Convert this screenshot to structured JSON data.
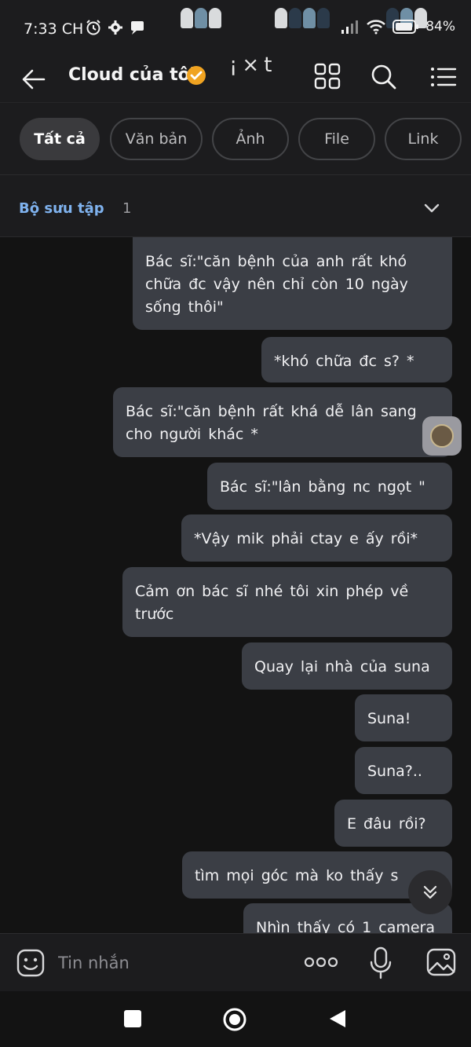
{
  "status_bar": {
    "time": "7:33",
    "period": "CH",
    "battery": "84%"
  },
  "header": {
    "title": "Cloud của tôi",
    "sticker_text": "¡×t"
  },
  "tabs": [
    {
      "label": "Tất cả",
      "active": true
    },
    {
      "label": "Văn bản",
      "active": false
    },
    {
      "label": "Ảnh",
      "active": false
    },
    {
      "label": "File",
      "active": false
    },
    {
      "label": "Link",
      "active": false
    }
  ],
  "collection": {
    "label": "Bộ sưu tập",
    "count": "1"
  },
  "messages": [
    {
      "text": "Bác sĩ:\"căn bệnh của anh rất khó chữa đc vậy nên chỉ còn 10 ngày sống thôi\""
    },
    {
      "text": "*khó chữa đc s? *"
    },
    {
      "text": "Bác sĩ:\"căn bệnh rất khá dễ lân sang cho người khác *"
    },
    {
      "text": "Bác sĩ:\"lân bằng nc ngọt \""
    },
    {
      "text": "*Vậy mik phải ctay e ấy rồi*"
    },
    {
      "text": "Cảm ơn bác sĩ nhé tôi xin phép về trước"
    },
    {
      "text": "Quay lại nhà của suna"
    },
    {
      "text": "Suna!"
    },
    {
      "text": "Suna?.."
    },
    {
      "text": "E đâu rồi?"
    },
    {
      "text": "tìm mọi góc mà ko thấy s"
    },
    {
      "text": "Nhìn thấy có 1 camera"
    }
  ],
  "input": {
    "placeholder": "Tin nhắn"
  },
  "colors": {
    "background": "#131313",
    "bar": "#1c1c1e",
    "bubble": "#3b3e45",
    "accent_blue": "#7fb2ee",
    "verified_orange": "#f0a321"
  },
  "icons": {
    "back": "arrow-left-icon",
    "verified": "verified-badge-icon",
    "grid": "grid-icon",
    "search": "search-icon",
    "menu": "list-menu-icon",
    "chevron": "chevron-down-icon",
    "emoji": "emoji-icon",
    "more": "more-dots-icon",
    "mic": "microphone-icon",
    "image": "image-icon",
    "scroll_down": "double-chevron-down-icon"
  }
}
